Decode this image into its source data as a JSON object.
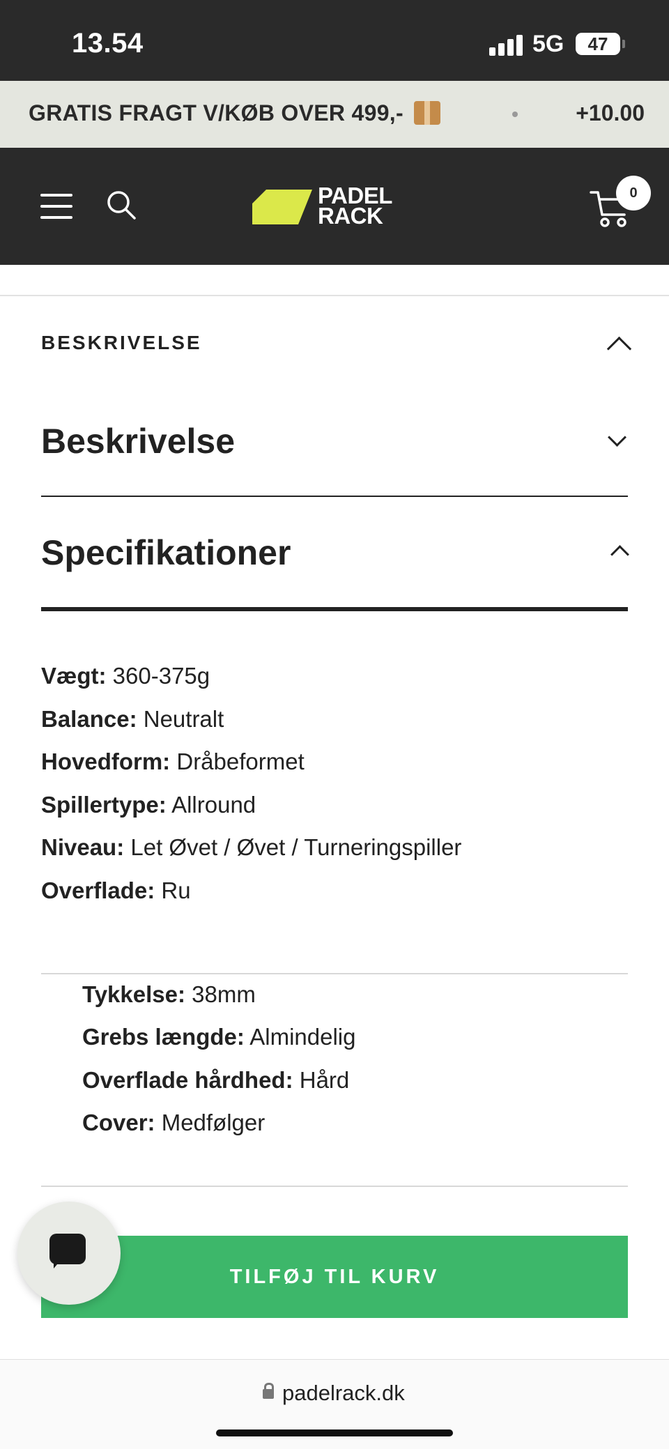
{
  "status_bar": {
    "time": "13.54",
    "network": "5G",
    "battery": "47"
  },
  "announcement": {
    "text": "GRATIS FRAGT V/KØB OVER 499,-",
    "right_text": "+10.00"
  },
  "header": {
    "logo_line1": "PADEL",
    "logo_line2": "RACK",
    "cart_count": "0",
    "logo_color": "#dbe84a"
  },
  "accordion": {
    "heading": "BESKRIVELSE"
  },
  "sections": {
    "description_title": "Beskrivelse",
    "specs_title": "Specifikationer"
  },
  "specs": [
    {
      "label": "Vægt:",
      "value": "360-375g"
    },
    {
      "label": "Balance:",
      "value": "Neutralt"
    },
    {
      "label": "Hovedform:",
      "value": "Dråbeformet"
    },
    {
      "label": "Spillertype:",
      "value": "Allround"
    },
    {
      "label": "Niveau:",
      "value": "Let Øvet / Øvet / Turneringspiller"
    },
    {
      "label": "Overflade:",
      "value": "Ru"
    }
  ],
  "specs_extra": [
    {
      "label": "Tykkelse:",
      "value": "38mm"
    },
    {
      "label": "Grebs længde:",
      "value": "Almindelig"
    },
    {
      "label": "Overflade hårdhed:",
      "value": "Hård"
    },
    {
      "label": "Cover:",
      "value": "Medfølger"
    }
  ],
  "cta": {
    "label": "TILFØJ TIL KURV",
    "color": "#3db76a"
  },
  "browser": {
    "url": "padelrack.dk"
  }
}
